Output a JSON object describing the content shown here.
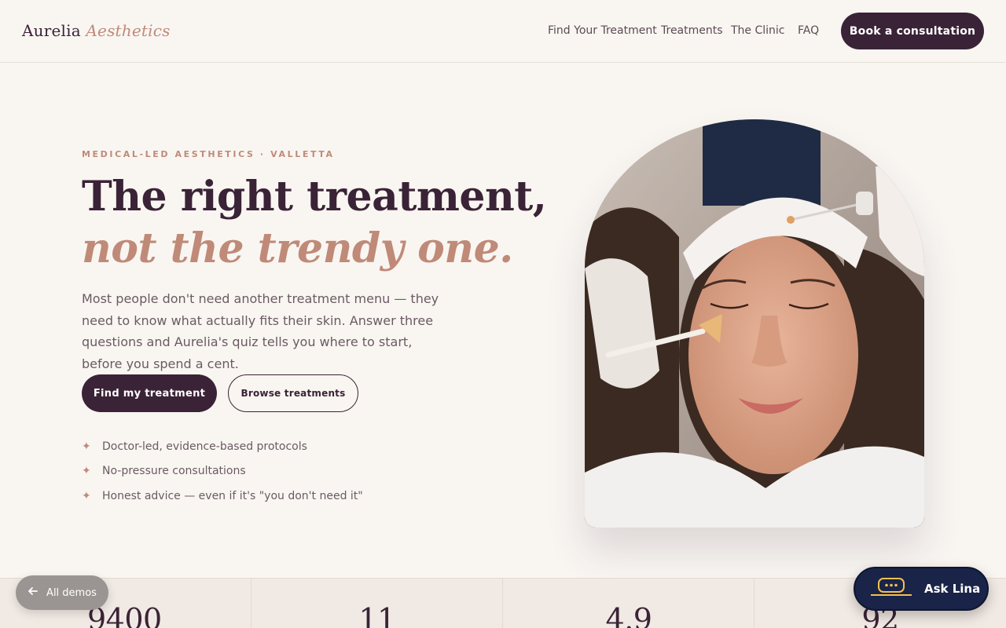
{
  "header": {
    "logo_main": "Aurelia",
    "logo_accent": "Aesthetics",
    "nav": [
      "Find Your Treatment",
      "Treatments",
      "The Clinic",
      "FAQ"
    ],
    "cta": "Book a consultation"
  },
  "hero": {
    "eyebrow": "MEDICAL-LED AESTHETICS · VALLETTA",
    "headline_line1": "The right treatment,",
    "headline_line2": "not the trendy one.",
    "lede": "Most people don't need another treatment menu — they need to know what actually fits their skin. Answer three questions and Aurelia's quiz tells you where to start, before you spend a cent.",
    "primary_button": "Find my treatment",
    "secondary_button": "Browse treatments",
    "features": [
      "Doctor-led, evidence-based protocols",
      "No-pressure consultations",
      "Honest advice — even if it's \"you don't need it\""
    ]
  },
  "stats": [
    "9400",
    "11",
    "4.9",
    "92"
  ],
  "floating": {
    "all_demos": "All demos",
    "ask": "Ask Lina"
  },
  "colors": {
    "plum": "#3a2336",
    "rose": "#c08a78",
    "cream": "#f9f6f2",
    "navy": "#1a2348",
    "gold": "#f2c14e"
  }
}
